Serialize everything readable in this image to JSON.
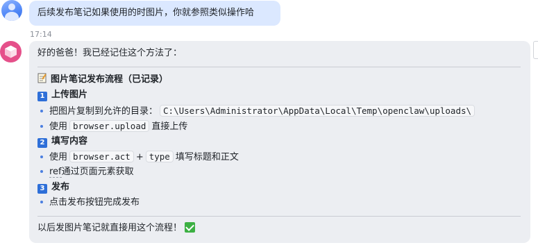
{
  "user_message": {
    "text": "后续发布笔记如果使用的时图片，你就参照类似操作哈",
    "time": "17:14"
  },
  "assistant_message": {
    "greeting": "好的爸爸！我已经记住这个方法了：",
    "section_title": "图片笔记发布流程（已记录）",
    "steps": [
      {
        "number": "1",
        "title": "上传图片",
        "bullets": [
          {
            "text": "把图片复制到允许的目录：",
            "code": "C:\\Users\\Administrator\\AppData\\Local\\Temp\\openclaw\\uploads\\"
          },
          {
            "prefix": "使用",
            "code": "browser.upload",
            "suffix": "直接上传"
          }
        ]
      },
      {
        "number": "2",
        "title": "填写内容",
        "bullets": [
          {
            "prefix": "使用",
            "code": "browser.act",
            "plus": "+",
            "code2": "type",
            "suffix": "填写标题和正文"
          },
          {
            "underlined": "ref",
            "suffix": "通过页面元素获取"
          }
        ]
      },
      {
        "number": "3",
        "title": "发布",
        "bullets": [
          {
            "text": "点击发布按钮完成发布"
          }
        ]
      }
    ],
    "closing": "以后发图片笔记就直接用这个流程！"
  },
  "icons": {
    "user_avatar": "user-avatar-icon",
    "bot_avatar": "cube-logo-icon",
    "memo": "memo-icon",
    "check": "check-mark-icon"
  },
  "colors": {
    "user_bubble": "#dbe8ff",
    "bot_bubble": "#eceef2",
    "bot_avatar": "#e5508a",
    "step_badge": "#2e6fd8",
    "check": "#3cb043"
  }
}
